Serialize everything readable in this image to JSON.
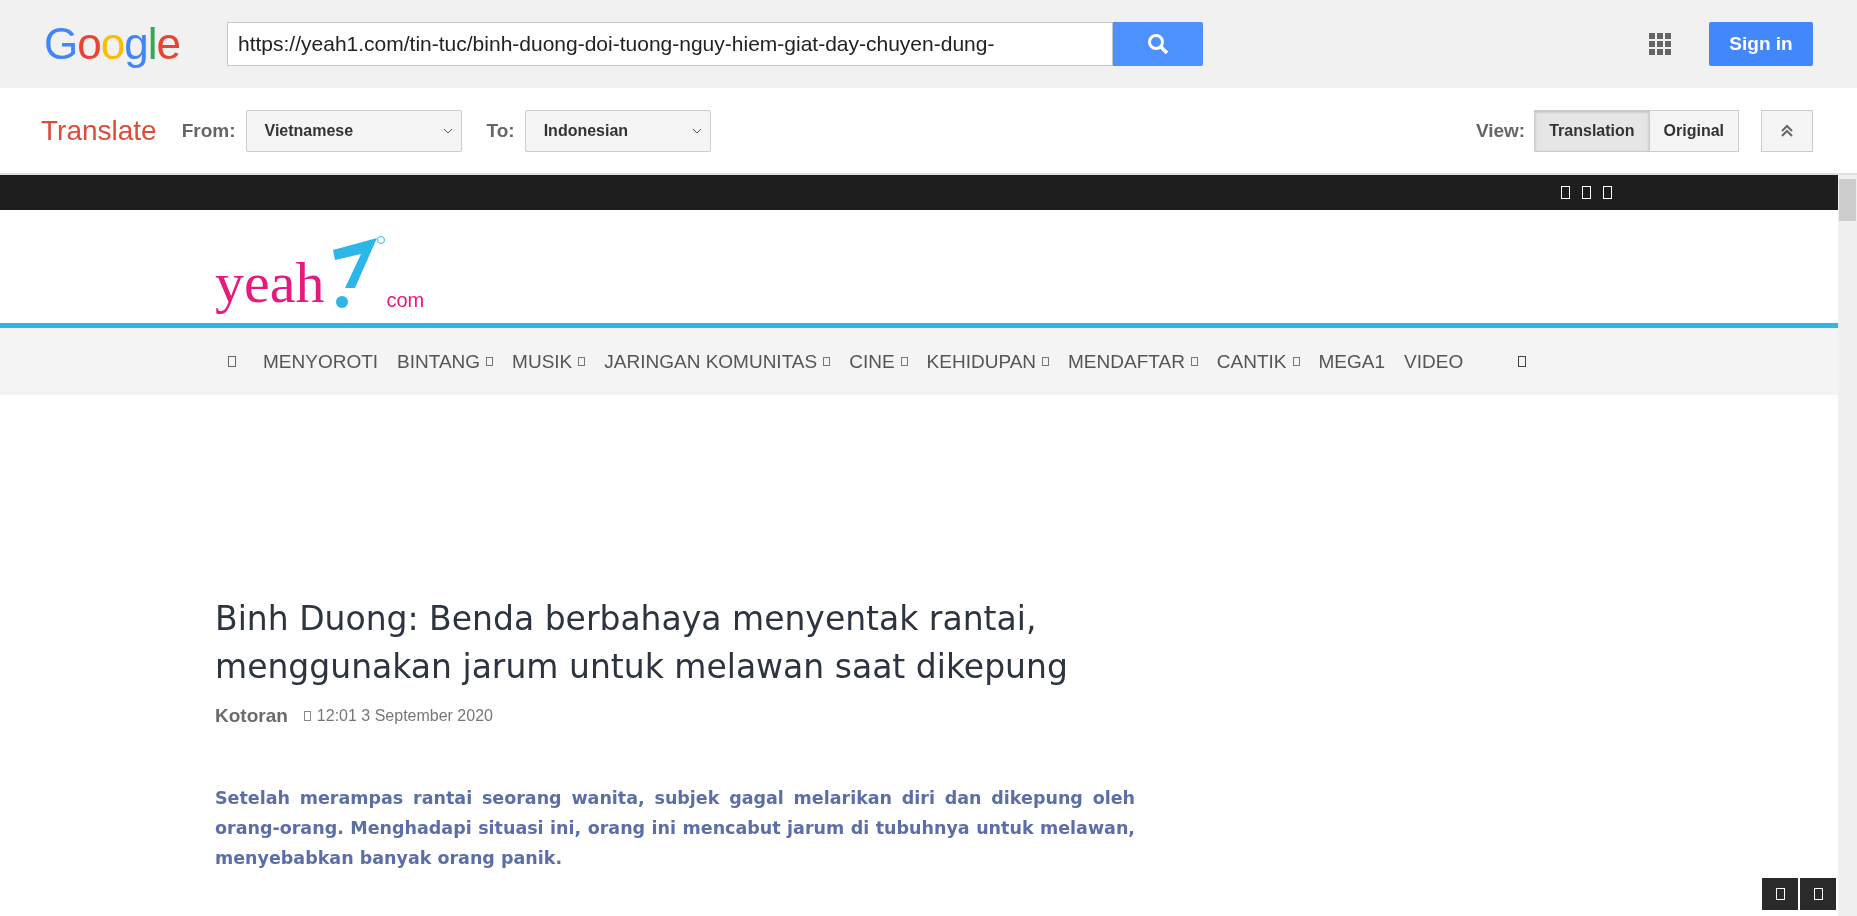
{
  "google_bar": {
    "logo": "Google",
    "url": "https://yeah1.com/tin-tuc/binh-duong-doi-tuong-nguy-hiem-giat-day-chuyen-dung-",
    "sign_in": "Sign in"
  },
  "translate_bar": {
    "title": "Translate",
    "from_label": "From:",
    "from_value": "Vietnamese",
    "to_label": "To:",
    "to_value": "Indonesian",
    "view_label": "View:",
    "view_options": [
      {
        "label": "Translation",
        "selected": true
      },
      {
        "label": "Original",
        "selected": false
      }
    ]
  },
  "site": {
    "logo": {
      "word": "yeah",
      "suffix": "com"
    },
    "nav": [
      {
        "label": "MENYOROTI",
        "dropdown": false
      },
      {
        "label": "BINTANG",
        "dropdown": true
      },
      {
        "label": "MUSIK",
        "dropdown": true
      },
      {
        "label": "JARINGAN KOMUNITAS",
        "dropdown": true
      },
      {
        "label": "CINE",
        "dropdown": true
      },
      {
        "label": "KEHIDUPAN",
        "dropdown": true
      },
      {
        "label": "MENDAFTAR",
        "dropdown": true
      },
      {
        "label": "CANTIK",
        "dropdown": true
      },
      {
        "label": "MEGA1",
        "dropdown": false
      },
      {
        "label": "VIDEO",
        "dropdown": false
      }
    ],
    "article": {
      "title": "Binh Duong: Benda berbahaya menyentak rantai, menggunakan jarum untuk melawan saat dikepung",
      "author": "Kotoran",
      "date": "12:01 3 September 2020",
      "lead": "Setelah merampas rantai seorang wanita, subjek gagal melarikan diri dan dikepung oleh orang-orang. Menghadapi situasi ini, orang ini mencabut jarum di tubuhnya untuk melawan, menyebabkan banyak orang panik."
    }
  }
}
